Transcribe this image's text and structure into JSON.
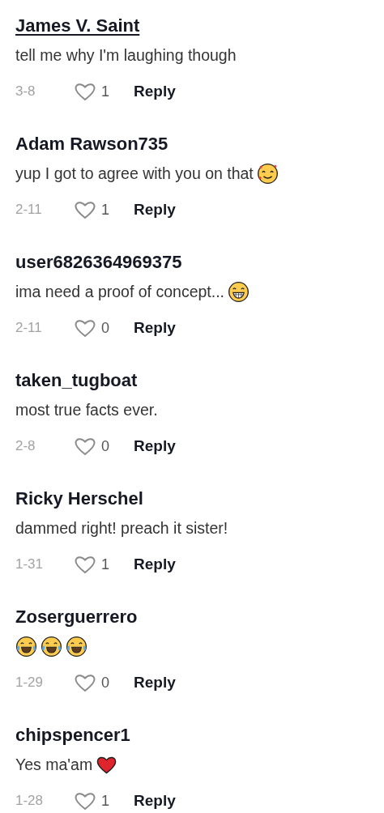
{
  "comments": [
    {
      "author": "James V. Saint",
      "underlined": true,
      "text": "tell me why I'm laughing though",
      "date": "3-8",
      "likes": "1",
      "reply": "Reply"
    },
    {
      "author": "Adam Rawson735",
      "underlined": false,
      "text": "yup I got to agree with you on that",
      "emojis": [
        {
          "kind": "hearts"
        }
      ],
      "date": "2-11",
      "likes": "1",
      "reply": "Reply"
    },
    {
      "author": "user6826364969375",
      "underlined": false,
      "text": "ima need a proof of concept...",
      "emojis": [
        {
          "kind": "grin"
        }
      ],
      "date": "2-11",
      "likes": "0",
      "reply": "Reply"
    },
    {
      "author": "taken_tugboat",
      "underlined": false,
      "text": "most true facts ever.",
      "date": "2-8",
      "likes": "0",
      "reply": "Reply"
    },
    {
      "author": "Ricky Herschel",
      "underlined": false,
      "text": "dammed right! preach it sister!",
      "date": "1-31",
      "likes": "1",
      "reply": "Reply"
    },
    {
      "author": "Zoserguerrero",
      "underlined": false,
      "emojis": [
        {
          "kind": "joy"
        },
        {
          "kind": "joy"
        },
        {
          "kind": "joy"
        }
      ],
      "date": "1-29",
      "likes": "0",
      "reply": "Reply"
    },
    {
      "author": "chipspencer1",
      "underlined": false,
      "text": "Yes ma'am",
      "emojis": [
        {
          "kind": "heart"
        }
      ],
      "date": "1-28",
      "likes": "1",
      "reply": "Reply"
    }
  ]
}
